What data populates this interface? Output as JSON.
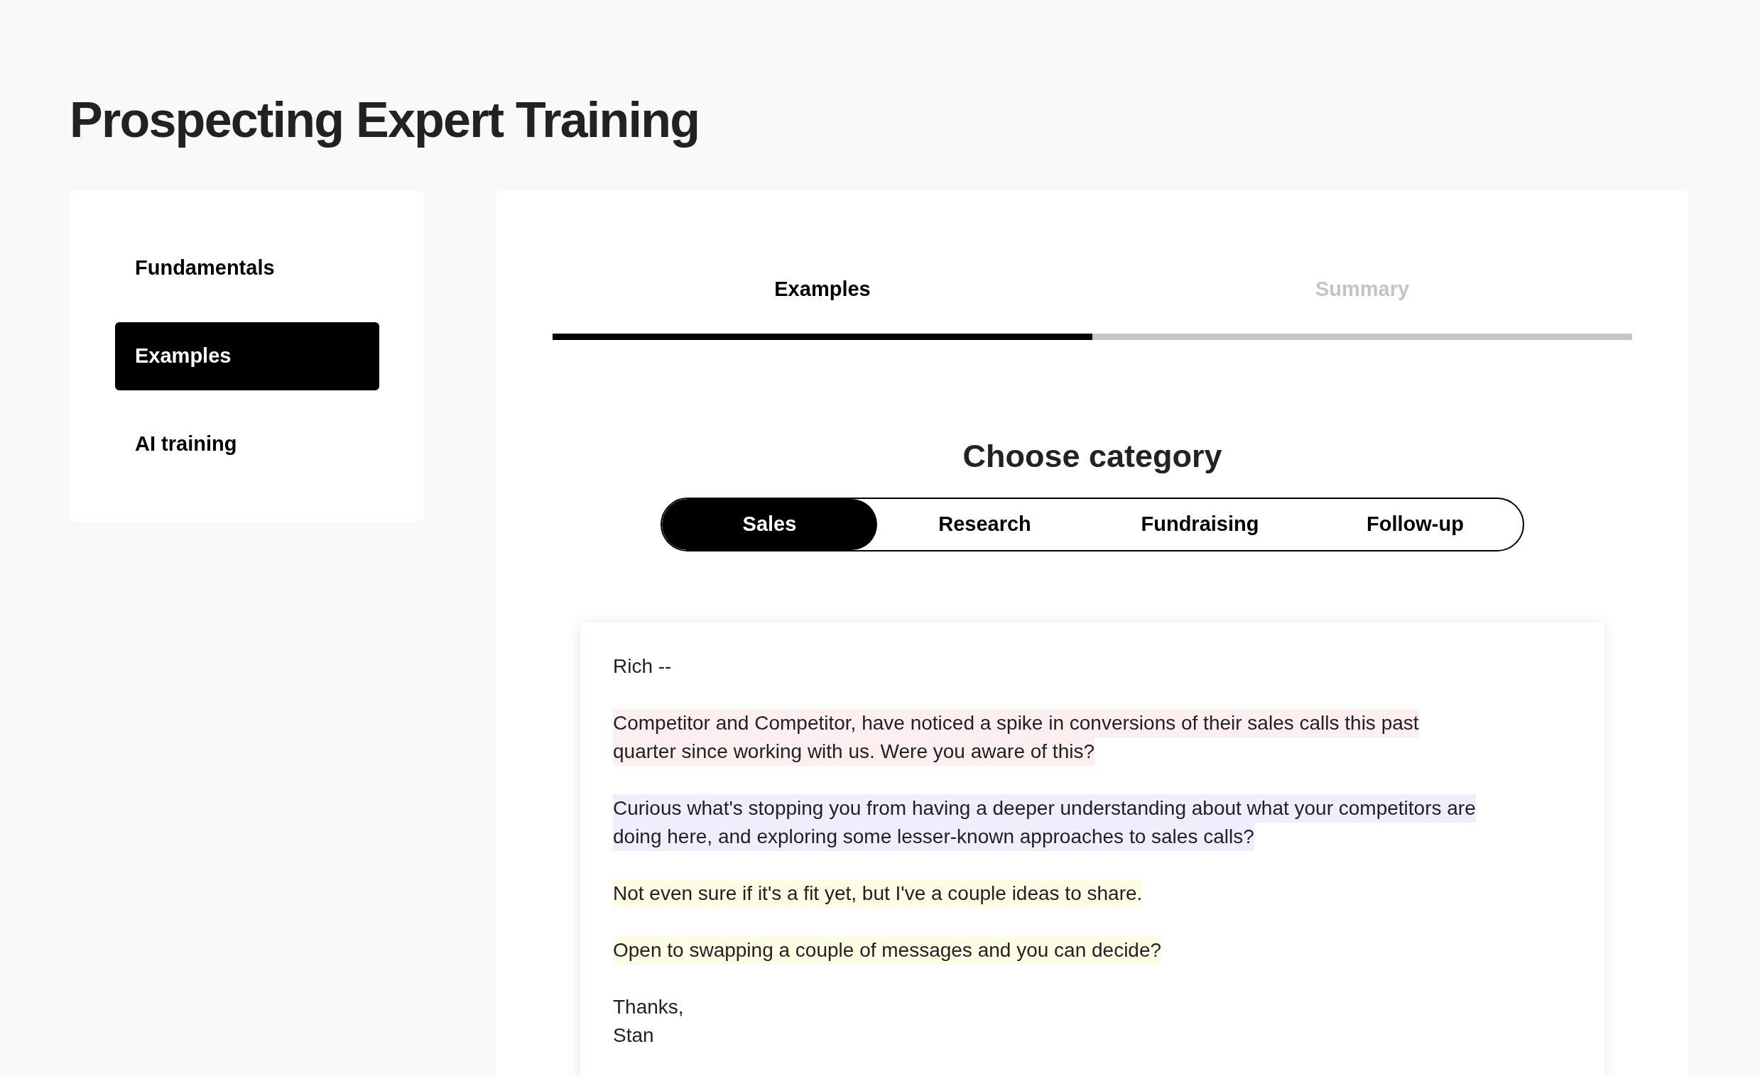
{
  "page": {
    "title": "Prospecting Expert Training"
  },
  "sidebar": {
    "items": [
      {
        "label": "Fundamentals",
        "selected": false
      },
      {
        "label": "Examples",
        "selected": true
      },
      {
        "label": "AI training",
        "selected": false
      }
    ]
  },
  "steps": [
    {
      "label": "Examples",
      "selected": true
    },
    {
      "label": "Summary",
      "selected": false
    }
  ],
  "category": {
    "heading": "Choose category",
    "options": [
      {
        "label": "Sales",
        "selected": true
      },
      {
        "label": "Research",
        "selected": false
      },
      {
        "label": "Fundraising",
        "selected": false
      },
      {
        "label": "Follow-up",
        "selected": false
      }
    ]
  },
  "email": {
    "paragraphs": [
      {
        "lines": [
          "Rich --"
        ]
      },
      {
        "lines": [
          "Competitor and Competitor, have noticed a spike in conversions of their sales calls this past",
          "quarter since working with us. Were you aware of this?"
        ],
        "color": "#fdeef0"
      },
      {
        "lines": [
          "Curious what's stopping you from having a deeper understanding about what your competitors are",
          "doing here, and exploring some lesser-known approaches to sales calls?"
        ],
        "color": "#eeeefc"
      },
      {
        "lines": [
          "Not even sure if it's a fit yet, but I've a couple ideas to share."
        ],
        "color": "#fdfde6"
      },
      {
        "lines": [
          "Open to swapping a couple of messages and you can decide?"
        ],
        "color": "#fdfde6"
      },
      {
        "lines": [
          "Thanks,",
          "Stan"
        ]
      }
    ]
  }
}
